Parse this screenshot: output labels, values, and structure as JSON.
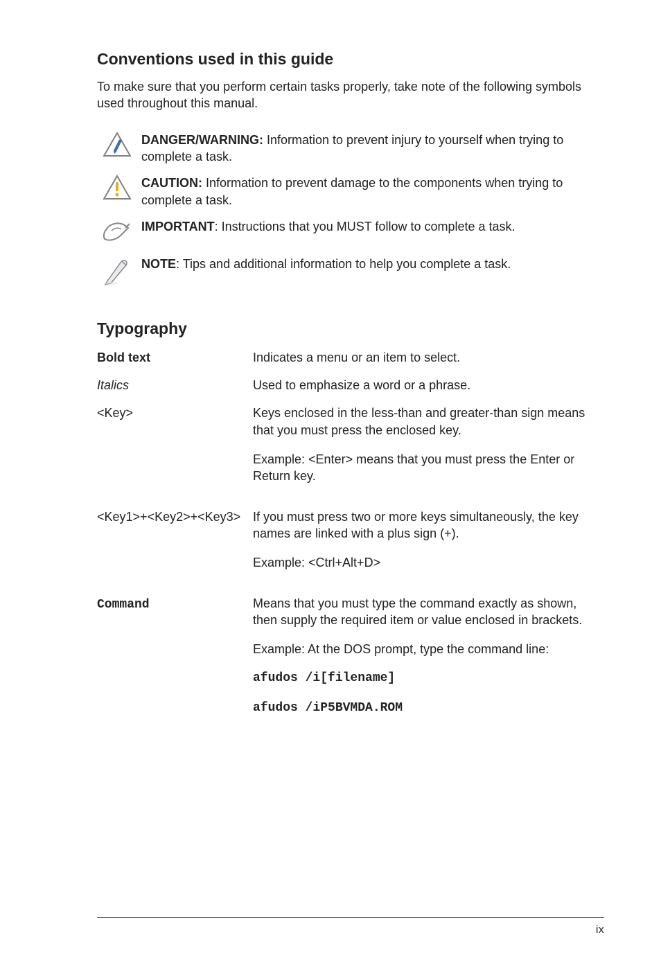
{
  "section1": {
    "title": "Conventions used in this guide",
    "intro": "To make sure that you perform certain tasks properly, take note of the following symbols used throughout this manual."
  },
  "notes": [
    {
      "label": "DANGER/WARNING:",
      "text": " Information to prevent injury to yourself when trying to complete a task."
    },
    {
      "label": "CAUTION:",
      "text": " Information to prevent damage to the components when trying to complete a task."
    },
    {
      "label": "IMPORTANT",
      "sep": ": ",
      "text": "Instructions that you MUST follow to complete a task."
    },
    {
      "label": "NOTE",
      "sep": ": ",
      "text": "Tips and additional information to help you complete a task."
    }
  ],
  "section2": {
    "title": "Typography"
  },
  "typo": {
    "bold_label": "Bold text",
    "bold_desc": "Indicates a menu or an item to select.",
    "italics_label": "Italics",
    "italics_desc": "Used to emphasize a word or a phrase.",
    "key_label": "<Key>",
    "key_desc1": "Keys enclosed in the less-than and greater-than sign means that you must press the enclosed key.",
    "key_desc2": "Example: <Enter> means that you must press the Enter or Return key.",
    "combo_label": "<Key1>+<Key2>+<Key3>",
    "combo_desc1": "If you must press two or more keys simultaneously, the key names are linked with a plus sign (+).",
    "combo_desc2": "Example: <Ctrl+Alt+D>",
    "cmd_label": "Command",
    "cmd_desc1": "Means that you must type the command exactly as shown, then supply the required item or value enclosed in brackets.",
    "cmd_desc2": "Example: At the DOS prompt, type the command line:",
    "cmd_code1": "afudos /i[filename]",
    "cmd_code2": "afudos /iP5BVMDA.ROM"
  },
  "footer": {
    "pagenum": "ix"
  }
}
